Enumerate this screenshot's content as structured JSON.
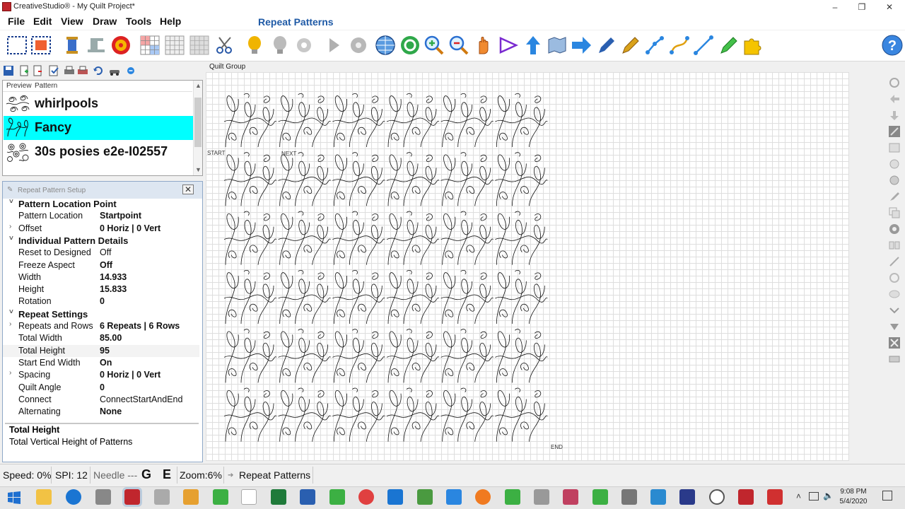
{
  "window": {
    "title": "CreativeStudio® - My Quilt Project*",
    "controls": [
      "–",
      "❐",
      "✕"
    ]
  },
  "menu": {
    "items": [
      "File",
      "Edit",
      "View",
      "Draw",
      "Tools",
      "Help"
    ],
    "mode_title": "Repeat Patterns"
  },
  "toolbar": {
    "icons": [
      "select-rect-icon",
      "select-fill-icon",
      "spool-icon",
      "sewing-machine-icon",
      "target-icon",
      "grid-color-icon",
      "grid-icon",
      "grid-gray-icon",
      "scissors-icon",
      "bulb-icon",
      "spool-gray-icon",
      "gear-gray-icon",
      "play-icon",
      "gear-icon",
      "globe-icon",
      "refresh-icon",
      "zoom-in-icon",
      "zoom-out-icon",
      "hand-icon",
      "triangle-pointer-icon",
      "up-arrow-icon",
      "map-icon",
      "right-arrow-icon",
      "pen-icon",
      "pencil-icon",
      "node-line-icon",
      "curve-icon",
      "line-icon",
      "marker-icon",
      "puzzle-icon",
      "help-icon"
    ]
  },
  "panel_toolbar": {
    "canvas_tab": "Quilt Group"
  },
  "pattern_list": {
    "headers": [
      "Preview",
      "Pattern"
    ],
    "items": [
      {
        "name": "whirlpools",
        "selected": false
      },
      {
        "name": "Fancy",
        "selected": true
      },
      {
        "name": "30s posies e2e-I02557",
        "selected": false
      }
    ],
    "selected_color": "#00ffff"
  },
  "setup": {
    "title": "Repeat Pattern Setup",
    "rows": [
      {
        "type": "cat",
        "key": "Pattern Location Point",
        "expand": "˅"
      },
      {
        "type": "prop",
        "key": "Pattern Location",
        "value": "Startpoint",
        "bold": true,
        "expand": ""
      },
      {
        "type": "prop",
        "key": "Offset",
        "value": "0 Horiz | 0 Vert",
        "bold": true,
        "expand": "›"
      },
      {
        "type": "cat",
        "key": "Individual Pattern Details",
        "expand": "˅"
      },
      {
        "type": "prop",
        "key": "Reset to Designed",
        "value": "Off",
        "bold": false,
        "expand": ""
      },
      {
        "type": "prop",
        "key": "Freeze Aspect",
        "value": "Off",
        "bold": true,
        "expand": ""
      },
      {
        "type": "prop",
        "key": "Width",
        "value": "14.933",
        "bold": true,
        "expand": ""
      },
      {
        "type": "prop",
        "key": "Height",
        "value": "15.833",
        "bold": true,
        "expand": ""
      },
      {
        "type": "prop",
        "key": "Rotation",
        "value": "0",
        "bold": true,
        "expand": ""
      },
      {
        "type": "cat",
        "key": "Repeat Settings",
        "expand": "˅"
      },
      {
        "type": "prop",
        "key": "Repeats and Rows",
        "value": "6 Repeats | 6 Rows",
        "bold": true,
        "expand": "›"
      },
      {
        "type": "prop",
        "key": "Total Width",
        "value": "85.00",
        "bold": true,
        "expand": ""
      },
      {
        "type": "prop",
        "key": "Total Height",
        "value": "95",
        "bold": true,
        "expand": ""
      },
      {
        "type": "prop",
        "key": "Start End Width",
        "value": "On",
        "bold": true,
        "expand": ""
      },
      {
        "type": "prop",
        "key": "Spacing",
        "value": "0 Horiz | 0 Vert",
        "bold": true,
        "expand": "›"
      },
      {
        "type": "prop",
        "key": "Quilt Angle",
        "value": "0",
        "bold": true,
        "expand": ""
      },
      {
        "type": "prop",
        "key": "Connect",
        "value": "ConnectStartAndEnd",
        "bold": false,
        "expand": ""
      },
      {
        "type": "prop",
        "key": "Alternating",
        "value": "None",
        "bold": true,
        "expand": ""
      }
    ],
    "description": {
      "title": "Total Height",
      "text": "Total Vertical Height of Patterns"
    }
  },
  "canvas": {
    "start_label": "START",
    "next_label": "NEXT",
    "end_label": "END",
    "repeats": 6,
    "rows": 6
  },
  "status": {
    "speed": "Speed: 0%",
    "spi": "SPI: 12",
    "needle": "Needle ---",
    "g": "G",
    "e": "E",
    "zoom": "Zoom:6%",
    "mode": "Repeat Patterns"
  },
  "taskbar": {
    "time": "9:08 PM",
    "date": "5/4/2020"
  }
}
